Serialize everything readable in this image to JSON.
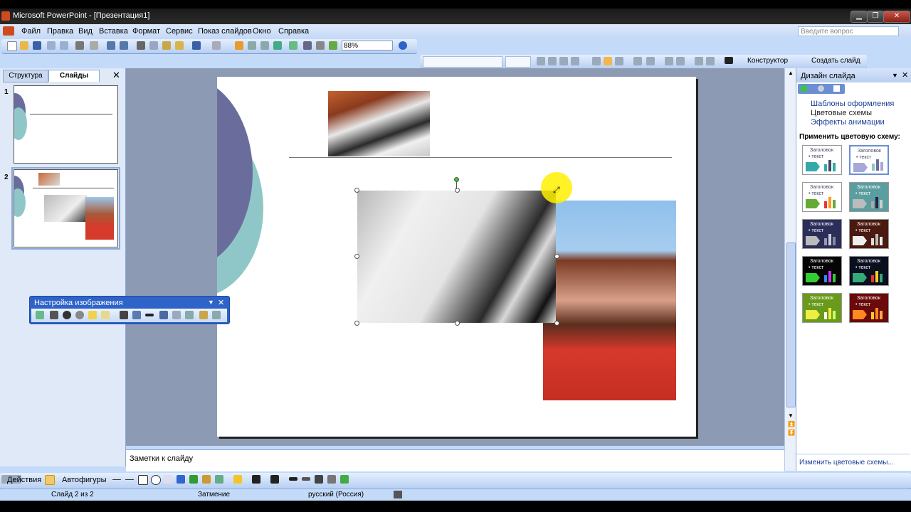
{
  "window": {
    "title": "Microsoft PowerPoint - [Презентация1]",
    "minimize": "▁",
    "maximize": "❐",
    "close": "✕"
  },
  "menu": {
    "items": [
      "Файл",
      "Правка",
      "Вид",
      "Вставка",
      "Формат",
      "Сервис",
      "Показ слайдов",
      "Окно",
      "Справка"
    ],
    "help_placeholder": "Введите вопрос"
  },
  "toolbar": {
    "zoom": "88%",
    "designer_label": "Конструктор",
    "new_slide_label": "Создать слайд"
  },
  "left_panel": {
    "tabs": [
      "Структура",
      "Слайды"
    ],
    "active_tab": "Слайды",
    "slides": [
      "1",
      "2"
    ]
  },
  "notes": {
    "placeholder": "Заметки к слайду"
  },
  "picture_toolbar": {
    "title": "Настройка изображения"
  },
  "task_pane": {
    "title": "Дизайн слайда",
    "links": [
      "Шаблоны оформления",
      "Цветовые схемы",
      "Эффекты анимации"
    ],
    "apply_label": "Применить цветовую схему:",
    "scheme_title": "Заголовок",
    "scheme_text": "• текст",
    "edit_link": "Изменить цветовые схемы..."
  },
  "drawing": {
    "actions_label": "Действия",
    "autoshapes_label": "Автофигуры"
  },
  "status": {
    "slide": "Слайд 2 из 2",
    "design": "Затмение",
    "language": "русский (Россия)"
  },
  "colors": {
    "accent": "#2e63c8",
    "slide_circle_dark": "#6a6d9c",
    "slide_circle_light": "#8fc7c8"
  }
}
